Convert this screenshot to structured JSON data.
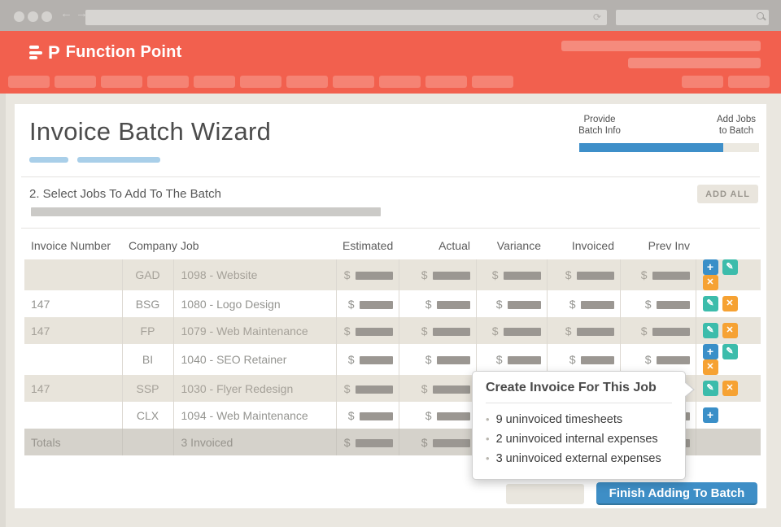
{
  "browser": {
    "back_icon": "left-arrow",
    "forward_icon": "right-arrow",
    "refresh_glyph": "⟳",
    "search_icon": "magnifier"
  },
  "header": {
    "brand": "Function Point",
    "logo_letter": "P"
  },
  "wizard": {
    "title": "Invoice Batch Wizard",
    "steps": [
      {
        "line1": "Provide",
        "line2": "Batch Info"
      },
      {
        "line1": "Add Jobs",
        "line2": "to Batch"
      }
    ],
    "progress_percent": 80,
    "section_title": "2. Select Jobs To Add To The Batch",
    "add_all_label": "ADD ALL"
  },
  "table": {
    "columns": [
      "Invoice Number",
      "Company",
      "Job",
      "Estimated",
      "Actual",
      "Variance",
      "Invoiced",
      "Prev Inv"
    ],
    "money_columns": 5,
    "rows": [
      {
        "invoice_number": "",
        "company": "GAD",
        "job": "1098 - Website",
        "actions": [
          "add",
          "edit",
          "remove"
        ],
        "shaded": true
      },
      {
        "invoice_number": "147",
        "company": "BSG",
        "job": "1080 - Logo Design",
        "actions": [
          "edit",
          "remove"
        ],
        "shaded": false
      },
      {
        "invoice_number": "147",
        "company": "FP",
        "job": "1079 - Web Maintenance",
        "actions": [
          "edit",
          "remove"
        ],
        "shaded": true
      },
      {
        "invoice_number": "",
        "company": "BI",
        "job": "1040 - SEO Retainer",
        "actions": [
          "add",
          "edit",
          "remove"
        ],
        "shaded": false
      },
      {
        "invoice_number": "147",
        "company": "SSP",
        "job": "1030 - Flyer Redesign",
        "actions": [
          "edit",
          "remove"
        ],
        "shaded": true
      },
      {
        "invoice_number": "",
        "company": "CLX",
        "job": "1094 - Web Maintenance",
        "actions": [
          "add"
        ],
        "shaded": false
      }
    ],
    "totals": {
      "label": "Totals",
      "invoiced_summary": "3 Invoiced"
    },
    "action_glyphs": {
      "add": "+",
      "edit": "✎",
      "remove": "✕"
    }
  },
  "tooltip": {
    "title": "Create Invoice For This Job",
    "items": [
      "9 uninvoiced timesheets",
      "2 uninvoiced internal expenses",
      "3 uninvoiced external expenses"
    ]
  },
  "footer": {
    "finish_label": "Finish Adding To Batch"
  },
  "colors": {
    "brand_red": "#f2604e",
    "accent_blue": "#3e8ec6",
    "teal": "#3cbcab",
    "orange": "#f6a233",
    "light_blue": "#a9cfe9",
    "page_bg": "#eae7e0",
    "shaded_row": "#e8e4db",
    "totals_row": "#d5d2cb"
  }
}
